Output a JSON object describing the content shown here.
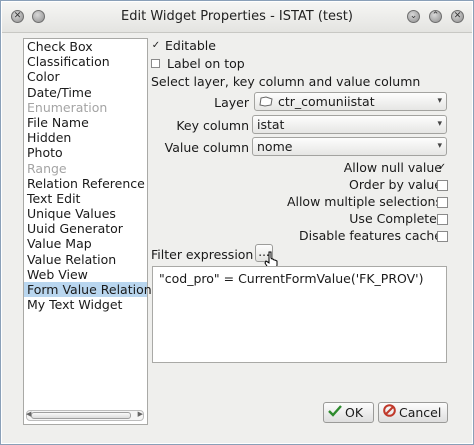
{
  "window": {
    "title": "Edit Widget Properties - ISTAT (test)"
  },
  "widget_list": [
    {
      "label": "Check Box",
      "state": "normal"
    },
    {
      "label": "Classification",
      "state": "normal"
    },
    {
      "label": "Color",
      "state": "normal"
    },
    {
      "label": "Date/Time",
      "state": "normal"
    },
    {
      "label": "Enumeration",
      "state": "disabled"
    },
    {
      "label": "File Name",
      "state": "normal"
    },
    {
      "label": "Hidden",
      "state": "normal"
    },
    {
      "label": "Photo",
      "state": "normal"
    },
    {
      "label": "Range",
      "state": "disabled"
    },
    {
      "label": "Relation Reference",
      "state": "normal"
    },
    {
      "label": "Text Edit",
      "state": "normal"
    },
    {
      "label": "Unique Values",
      "state": "normal"
    },
    {
      "label": "Uuid Generator",
      "state": "normal"
    },
    {
      "label": "Value Map",
      "state": "normal"
    },
    {
      "label": "Value Relation",
      "state": "normal"
    },
    {
      "label": "Web View",
      "state": "normal"
    },
    {
      "label": "Form Value Relation",
      "state": "selected"
    },
    {
      "label": "My Text Widget",
      "state": "normal"
    }
  ],
  "top_options": {
    "editable": {
      "label": "Editable",
      "checked": true
    },
    "label_on_top": {
      "label": "Label on top",
      "checked": false
    }
  },
  "section_heading": "Select layer, key column and value column",
  "layer": {
    "label": "Layer",
    "value": "ctr_comuniistat"
  },
  "key_column": {
    "label": "Key column",
    "value": "istat"
  },
  "value_column": {
    "label": "Value column",
    "value": "nome"
  },
  "options": [
    {
      "label": "Allow null value",
      "checked": true
    },
    {
      "label": "Order by value",
      "checked": false
    },
    {
      "label": "Allow multiple selections",
      "checked": false
    },
    {
      "label": "Use Completer",
      "checked": false
    },
    {
      "label": "Disable features cache",
      "checked": false
    }
  ],
  "filter": {
    "label": "Filter expression",
    "button_label": "...",
    "expression": "\"cod_pro\" =  CurrentFormValue('FK_PROV')"
  },
  "buttons": {
    "ok": "OK",
    "cancel": "Cancel"
  },
  "colors": {
    "selection": "#b9d6ef",
    "ok_check": "#2e8b2e",
    "cancel_icon": "#c0392b"
  }
}
